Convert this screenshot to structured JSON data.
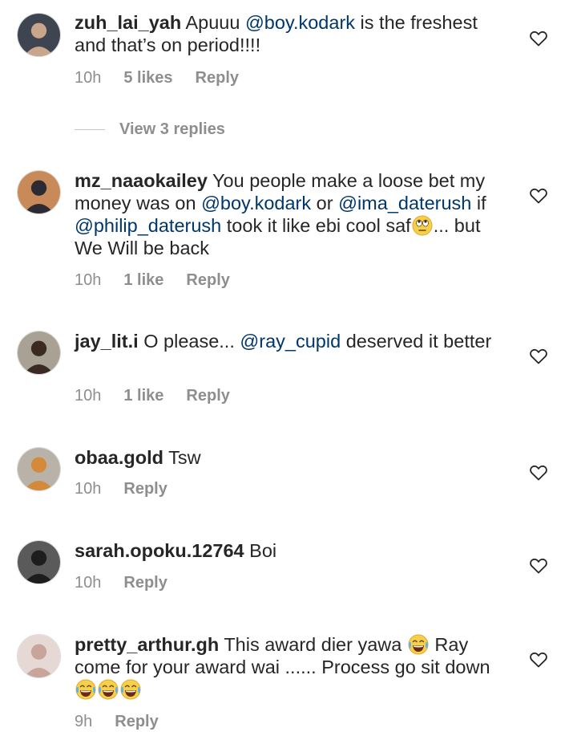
{
  "comments": [
    {
      "username": "zuh_lai_yah",
      "segments": [
        {
          "t": "Apuuu ",
          "k": "text"
        },
        {
          "t": "@boy.kodark",
          "k": "mention"
        },
        {
          "t": " is the freshest and that’s on period!!!!",
          "k": "text"
        }
      ],
      "time": "10h",
      "likes": "5 likes",
      "reply": "Reply",
      "view_replies": "View 3 replies",
      "avatar_colors": [
        "#3e4550",
        "#c9a58b"
      ]
    },
    {
      "username": "mz_naaokailey",
      "segments": [
        {
          "t": "You people make a loose bet my money was on ",
          "k": "text"
        },
        {
          "t": "@boy.kodark",
          "k": "mention"
        },
        {
          "t": " or ",
          "k": "text"
        },
        {
          "t": "@ima_daterush",
          "k": "mention"
        },
        {
          "t": " if ",
          "k": "text"
        },
        {
          "t": "@philip_daterush",
          "k": "mention"
        },
        {
          "t": " took it like ebi cool saf",
          "k": "text"
        },
        {
          "t": "face-with-rolling-eyes",
          "k": "emoji"
        },
        {
          "t": "... but We Will be back",
          "k": "text"
        }
      ],
      "time": "10h",
      "likes": "1 like",
      "reply": "Reply",
      "avatar_colors": [
        "#c98a5a",
        "#2c2b33"
      ]
    },
    {
      "username": "jay_lit.i",
      "segments": [
        {
          "t": "O please... ",
          "k": "text"
        },
        {
          "t": "@ray_cupid",
          "k": "mention"
        },
        {
          "t": " deserved it better",
          "k": "text"
        }
      ],
      "time": "10h",
      "likes": "1 like",
      "reply": "Reply",
      "avatar_colors": [
        "#a9a294",
        "#3a2a22"
      ]
    },
    {
      "username": "obaa.gold",
      "segments": [
        {
          "t": "Tsw",
          "k": "text"
        }
      ],
      "time": "10h",
      "likes": "",
      "reply": "Reply",
      "avatar_colors": [
        "#b9b2a8",
        "#d48a3a"
      ]
    },
    {
      "username": "sarah.opoku.12764",
      "segments": [
        {
          "t": "Boi",
          "k": "text"
        }
      ],
      "time": "10h",
      "likes": "",
      "reply": "Reply",
      "avatar_colors": [
        "#5a5a5a",
        "#1d1d1d"
      ]
    },
    {
      "username": "pretty_arthur.gh",
      "segments": [
        {
          "t": "This award dier yawa ",
          "k": "text"
        },
        {
          "t": "face-with-tears-of-joy",
          "k": "emoji"
        },
        {
          "t": " Ray come for your award wai ...... Process go sit down",
          "k": "text"
        },
        {
          "t": "face-with-tears-of-joy",
          "k": "emoji"
        },
        {
          "t": "face-with-tears-of-joy",
          "k": "emoji"
        },
        {
          "t": "face-with-tears-of-joy",
          "k": "emoji"
        }
      ],
      "time": "9h",
      "likes": "",
      "reply": "Reply",
      "avatar_colors": [
        "#e6d8d4",
        "#c9a49a"
      ]
    }
  ]
}
